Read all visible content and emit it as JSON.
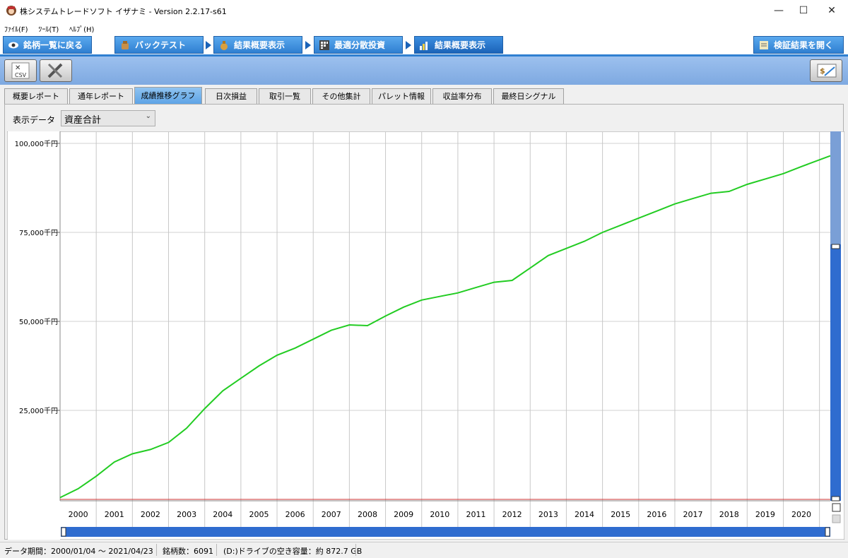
{
  "window": {
    "title": "株システムトレードソフト イザナミ - Version 2.2.17-s61",
    "minimize": "—",
    "maximize": "☐",
    "close": "✕"
  },
  "menu": {
    "items": [
      "ﾌｧｲﾙ(F)",
      "ﾂｰﾙ(T)",
      "ﾍﾙﾌﾟ(H)"
    ]
  },
  "nav": {
    "back": "銘柄一覧に戻る",
    "backtest": "バックテスト",
    "summary1": "結果概要表示",
    "optimal": "最適分散投資",
    "summary2": "結果概要表示",
    "open_results": "検証結果を開く"
  },
  "toolbar": {
    "csv_label": "CSV"
  },
  "subtabs": [
    "概要レポート",
    "通年レポート",
    "成績推移グラフ",
    "日次損益",
    "取引一覧",
    "その他集計",
    "パレット情報",
    "収益率分布",
    "最終日シグナル"
  ],
  "active_subtab": "成績推移グラフ",
  "display": {
    "label": "表示データ",
    "selected": "資産合計"
  },
  "status": {
    "period": "データ期間：2000/01/04 〜 2021/04/23",
    "count": "銘柄数：6091",
    "drive": "(D:)ドライブの空き容量：約 872.7 GB"
  },
  "colors": {
    "line": "#22cc22",
    "baseline": "#cc3333",
    "accent": "#2f7fd1"
  },
  "chart_data": {
    "type": "line",
    "ytick_labels": [
      "100,000千円",
      "75,000千円",
      "50,000千円",
      "25,000千円"
    ],
    "ytick_values": [
      100000,
      75000,
      50000,
      25000
    ],
    "ylim": [
      0,
      100000
    ],
    "categories": [
      "2000",
      "2001",
      "2002",
      "2003",
      "2004",
      "2005",
      "2006",
      "2007",
      "2008",
      "2009",
      "2010",
      "2011",
      "2012",
      "2013",
      "2014",
      "2015",
      "2016",
      "2017",
      "2018",
      "2019",
      "2020"
    ],
    "grid": true,
    "series": [
      {
        "color": "#22cc22",
        "x": [
          2000.0,
          2000.5,
          2001.0,
          2001.5,
          2002.0,
          2002.5,
          2003.0,
          2003.5,
          2004.0,
          2004.5,
          2005.0,
          2005.5,
          2006.0,
          2006.5,
          2007.0,
          2007.5,
          2008.0,
          2008.5,
          2009.0,
          2009.5,
          2010.0,
          2010.5,
          2011.0,
          2011.5,
          2012.0,
          2012.5,
          2013.0,
          2013.5,
          2014.0,
          2014.5,
          2015.0,
          2015.5,
          2016.0,
          2016.5,
          2017.0,
          2017.5,
          2018.0,
          2018.5,
          2019.0,
          2019.5,
          2020.0,
          2020.5,
          2021.3
        ],
        "values": [
          500,
          3000,
          6500,
          10500,
          12800,
          14000,
          16000,
          20000,
          25500,
          30500,
          34000,
          37500,
          40500,
          42500,
          45000,
          47500,
          49000,
          48800,
          51500,
          54000,
          56000,
          57000,
          58000,
          59500,
          61000,
          61500,
          65000,
          68500,
          70500,
          72500,
          75000,
          77000,
          79000,
          81000,
          83000,
          84500,
          86000,
          86500,
          88500,
          90000,
          91500,
          93500,
          96500
        ]
      },
      {
        "color": "#cc3333",
        "x": [
          2000.0,
          2021.3
        ],
        "values": [
          0,
          0
        ]
      }
    ]
  }
}
